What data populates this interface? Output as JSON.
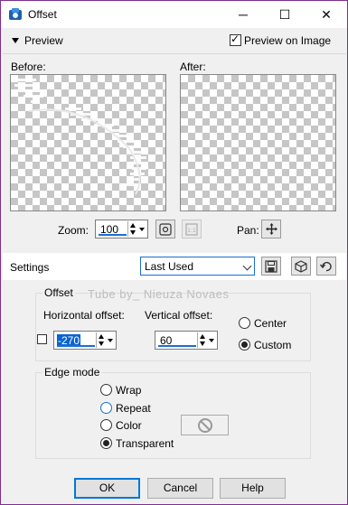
{
  "window": {
    "title": "Offset",
    "icon": "paint-shop-pro-icon",
    "controls": {
      "minimize": "─",
      "maximize": "☐",
      "close": "✕"
    }
  },
  "preview": {
    "toggle_label": "Preview",
    "preview_on_image_label": "Preview on Image",
    "preview_on_image_checked": true,
    "before_label": "Before:",
    "after_label": "After:"
  },
  "zoom": {
    "label": "Zoom:",
    "value": "100",
    "pan_label": "Pan:",
    "pan_icon": "move-icon"
  },
  "settings": {
    "label": "Settings",
    "preset_value": "Last Used",
    "icons": [
      "save-preset-icon",
      "cube-icon",
      "reset-icon"
    ]
  },
  "offset": {
    "group_title": "Offset",
    "watermark": "Tube by_ Nieuza Novaes",
    "horizontal_label": "Horizontal offset:",
    "horizontal_value": "-270",
    "horizontal_checkbox_checked": false,
    "vertical_label": "Vertical offset:",
    "vertical_value": "60",
    "position_options": [
      "Center",
      "Custom"
    ],
    "position_selected": "Custom"
  },
  "edge_mode": {
    "group_title": "Edge mode",
    "options": [
      "Wrap",
      "Repeat",
      "Color",
      "Transparent"
    ],
    "selected": "Transparent"
  },
  "buttons": {
    "ok": "OK",
    "cancel": "Cancel",
    "help": "Help"
  },
  "colors": {
    "accent": "#1a6fd0",
    "window_border": "#7e2f8e",
    "dialog_bg": "#f0f0f0"
  }
}
